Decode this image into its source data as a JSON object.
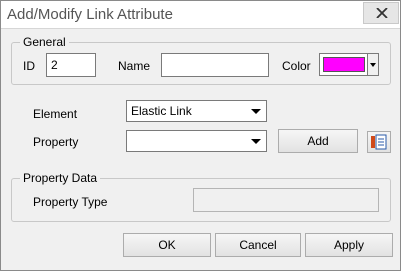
{
  "window": {
    "title": "Add/Modify Link Attribute"
  },
  "general": {
    "legend": "General",
    "id_label": "ID",
    "id_value": "2",
    "name_label": "Name",
    "name_value": "",
    "color_label": "Color",
    "color_value": "#ff00ff"
  },
  "element": {
    "label": "Element",
    "value": "Elastic Link"
  },
  "property": {
    "label": "Property",
    "value": "",
    "add_label": "Add"
  },
  "property_data": {
    "legend": "Property Data",
    "type_label": "Property Type",
    "type_value": ""
  },
  "buttons": {
    "ok": "OK",
    "cancel": "Cancel",
    "apply": "Apply"
  },
  "icons": {
    "close": "close-icon",
    "dropdown": "chevron-down-icon",
    "property_data": "property-data-icon"
  }
}
